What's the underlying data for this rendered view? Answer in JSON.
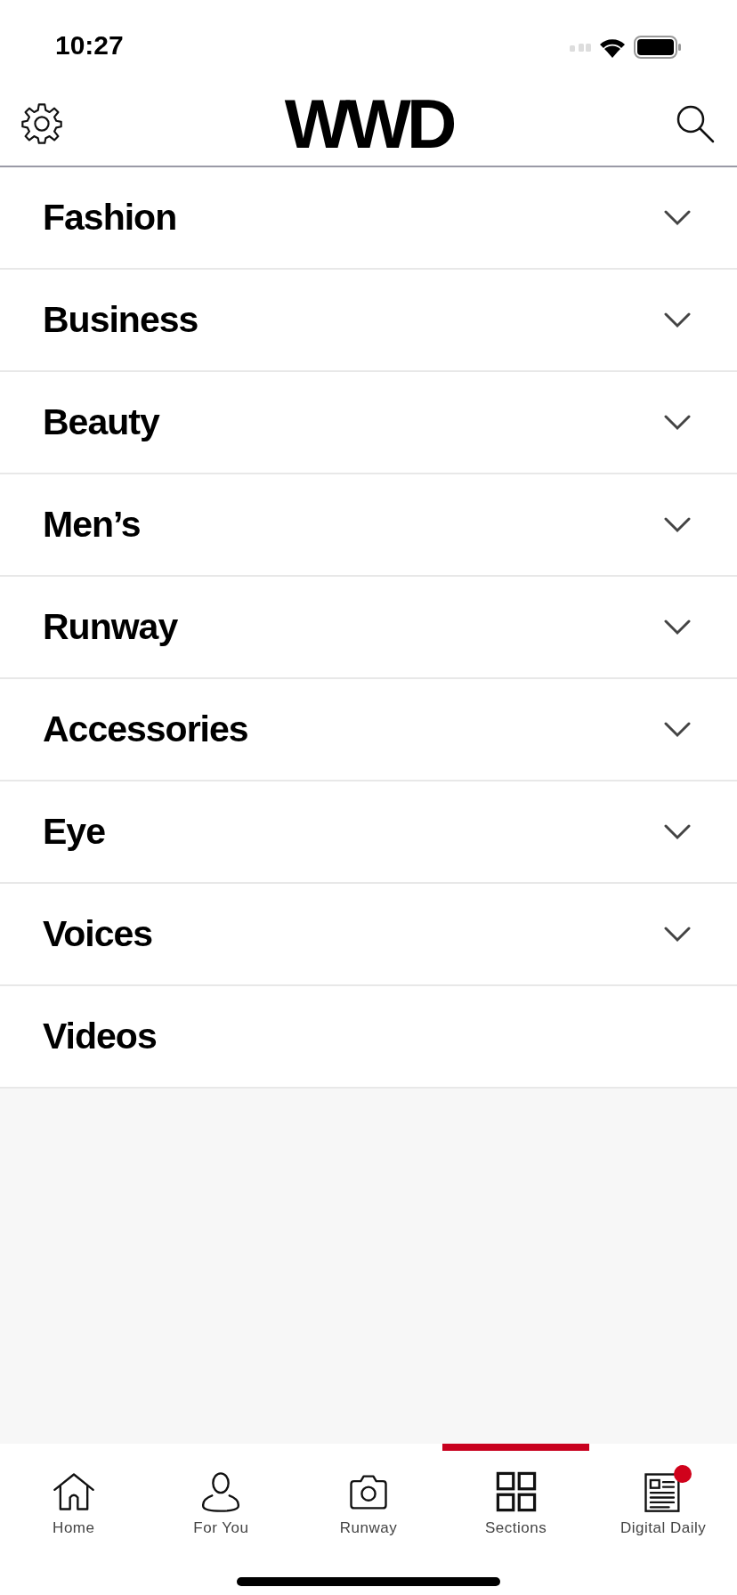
{
  "status_bar": {
    "time": "10:27"
  },
  "header": {
    "logo": "WWD"
  },
  "sections": [
    {
      "label": "Fashion",
      "kind": "expandable",
      "expanded": false
    },
    {
      "label": "Business",
      "kind": "expandable",
      "expanded": false
    },
    {
      "label": "Beauty",
      "kind": "expandable",
      "expanded": false
    },
    {
      "label": "Men’s",
      "kind": "expandable",
      "expanded": false
    },
    {
      "label": "Runway",
      "kind": "expandable",
      "expanded": false
    },
    {
      "label": "Accessories",
      "kind": "expandable",
      "expanded": false
    },
    {
      "label": "Eye",
      "kind": "expandable",
      "expanded": false
    },
    {
      "label": "Voices",
      "kind": "expandable",
      "expanded": false
    },
    {
      "label": "Videos",
      "kind": "link"
    }
  ],
  "tab_bar": [
    {
      "label": "Home",
      "kind": "home",
      "selected": false,
      "badge": false
    },
    {
      "label": "For You",
      "kind": "person",
      "selected": false,
      "badge": false
    },
    {
      "label": "Runway",
      "kind": "camera",
      "selected": false,
      "badge": false
    },
    {
      "label": "Sections",
      "kind": "grid",
      "selected": true,
      "badge": false
    },
    {
      "label": "Digital Daily",
      "kind": "newspaper",
      "selected": false,
      "badge": true
    }
  ]
}
